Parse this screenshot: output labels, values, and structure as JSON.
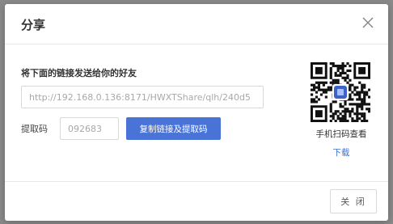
{
  "dialog": {
    "title": "分享",
    "close_icon": "close-icon",
    "instruction": "将下面的链接发送给你的好友",
    "link_value": "http://192.168.0.136:8171/HWXTShare/qlh/240d5",
    "code_label": "提取码",
    "code_value": "092683",
    "copy_button_label": "复制链接及提取码",
    "qr_caption": "手机扫码查看",
    "download_label": "下载",
    "close_button_label": "关 闭"
  },
  "colors": {
    "accent": "#4a73d8",
    "link": "#3a6fd6"
  }
}
